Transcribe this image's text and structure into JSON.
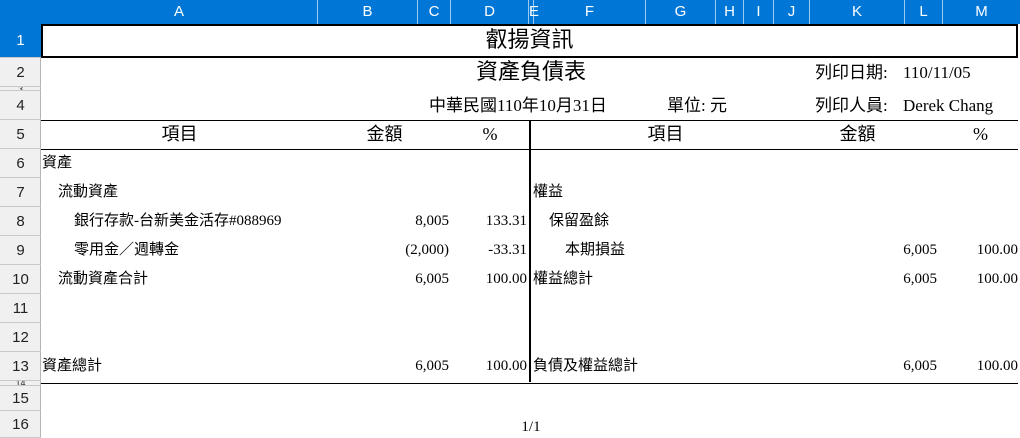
{
  "columns": [
    "A",
    "B",
    "C",
    "D",
    "E",
    "F",
    "G",
    "H",
    "I",
    "J",
    "K",
    "L",
    "M"
  ],
  "rows": [
    "1",
    "2",
    "3",
    "4",
    "5",
    "6",
    "7",
    "8",
    "9",
    "10",
    "11",
    "12",
    "13",
    "14",
    "15",
    "16"
  ],
  "report": {
    "company": "叡揚資訊",
    "title": "資產負債表",
    "date_label": "中華民國110年10月31日",
    "unit_label": "單位: 元",
    "print_date_label": "列印日期:",
    "print_date": "110/11/05",
    "printer_label": "列印人員:",
    "printer": "Derek Chang"
  },
  "headers": {
    "left_item": "項目",
    "left_amount": "金額",
    "left_pct": "%",
    "right_item": "項目",
    "right_amount": "金額",
    "right_pct": "%"
  },
  "left": {
    "assets": "資產",
    "current_assets": "流動資產",
    "bank_label": "銀行存款-台新美金活存#088969",
    "bank_amount": "8,005",
    "bank_pct": "133.31",
    "petty_label": "零用金／週轉金",
    "petty_amount": "(2,000)",
    "petty_pct": "-33.31",
    "current_total_label": "流動資產合計",
    "current_total_amount": "6,005",
    "current_total_pct": "100.00",
    "assets_total_label": "資產總計",
    "assets_total_amount": "6,005",
    "assets_total_pct": "100.00"
  },
  "right": {
    "equity": "權益",
    "retained": "保留盈餘",
    "period_pl_label": "本期損益",
    "period_pl_amount": "6,005",
    "period_pl_pct": "100.00",
    "equity_total_label": "權益總計",
    "equity_total_amount": "6,005",
    "equity_total_pct": "100.00",
    "liab_equity_total_label": "負債及權益總計",
    "liab_equity_total_amount": "6,005",
    "liab_equity_total_pct": "100.00"
  },
  "page_number": "1/1",
  "colors": {
    "header_blue": "#0077d6"
  }
}
